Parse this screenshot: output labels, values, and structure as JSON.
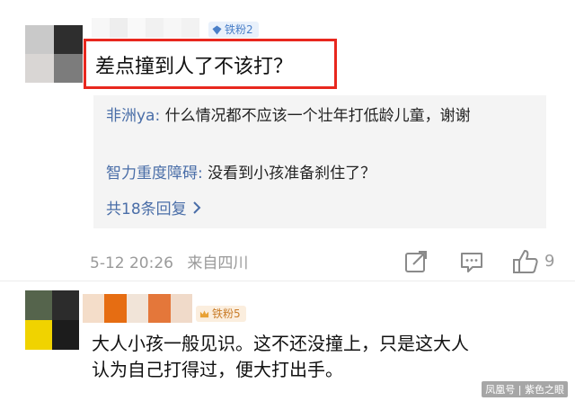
{
  "comments": [
    {
      "fan_badge": "铁粉2",
      "text": "差点撞到人了不该打？",
      "replies": [
        {
          "author": "非洲ya",
          "separator": ": ",
          "text": "什么情况都不应该一个壮年打低龄儿童，谢谢"
        },
        {
          "author": "智力重度障碍",
          "separator": ": ",
          "text": "没看到小孩准备刹住了？"
        }
      ],
      "more_replies_label": "共18条回复",
      "timestamp": "5-12 20:26",
      "location": "来自四川",
      "like_count": "9"
    },
    {
      "fan_badge": "铁粉5",
      "text": "大人小孩一般见识。这不还没撞上，只是这大人认为自己打得过，便大打出手。"
    }
  ],
  "watermark": "凤凰号 | 紫色之眼",
  "icons": {
    "fan_badge_1": "diamond-icon",
    "fan_badge_2": "crown-icon",
    "share": "share-icon",
    "comment": "comment-icon",
    "like": "thumbs-up-icon",
    "more": "chevron-right-icon"
  },
  "colors": {
    "highlight_border": "#e8271e",
    "reply_author": "#4a6ea8",
    "reply_panel_bg": "#f4f4f4",
    "meta_text": "#9a9a9a"
  }
}
